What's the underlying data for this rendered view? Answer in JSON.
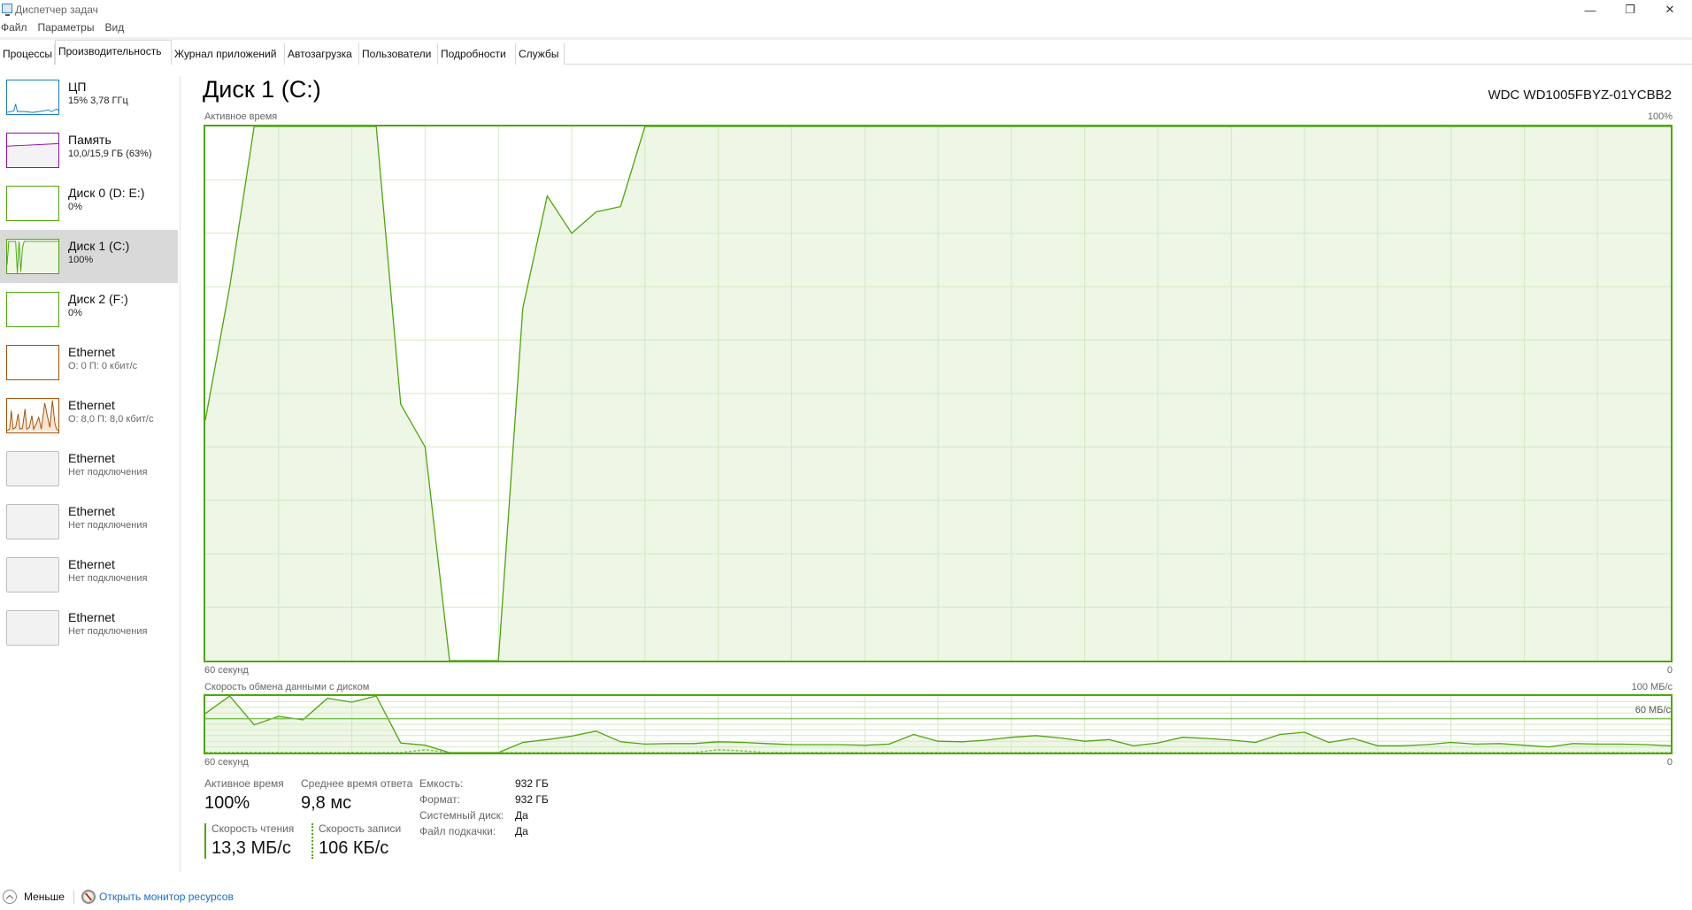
{
  "window": {
    "title": "Диспетчер задач",
    "controls": {
      "minimize": "—",
      "maximize": "❐",
      "close": "✕"
    }
  },
  "menu": [
    "Файл",
    "Параметры",
    "Вид"
  ],
  "tabs": [
    {
      "label": "Процессы",
      "active": false
    },
    {
      "label": "Производительность",
      "active": true
    },
    {
      "label": "Журнал приложений",
      "active": false
    },
    {
      "label": "Автозагрузка",
      "active": false
    },
    {
      "label": "Пользователи",
      "active": false
    },
    {
      "label": "Подробности",
      "active": false
    },
    {
      "label": "Службы",
      "active": false
    }
  ],
  "sidebar": {
    "items": [
      {
        "title": "ЦП",
        "subtitle": "15% 3,78 ГГц",
        "kind": "cpu",
        "color": "#1a7bbf",
        "selected": false
      },
      {
        "title": "Память",
        "subtitle": "10,0/15,9 ГБ (63%)",
        "kind": "memory",
        "color": "#8b12ae",
        "selected": false
      },
      {
        "title": "Диск 0 (D: E:)",
        "subtitle": "0%",
        "kind": "disk-idle",
        "color": "#4da60c",
        "selected": false
      },
      {
        "title": "Диск 1 (C:)",
        "subtitle": "100%",
        "kind": "disk-active",
        "color": "#4da60c",
        "selected": true
      },
      {
        "title": "Диск 2 (F:)",
        "subtitle": "0%",
        "kind": "disk-idle",
        "color": "#4da60c",
        "selected": false
      },
      {
        "title": "Ethernet",
        "subtitle": "О: 0 П: 0 кбит/с",
        "kind": "eth-idle",
        "color": "#a74f01",
        "selected": false
      },
      {
        "title": "Ethernet",
        "subtitle": "О: 8,0 П: 8,0 кбит/с",
        "kind": "eth-active",
        "color": "#a74f01",
        "selected": false
      },
      {
        "title": "Ethernet",
        "subtitle": "Нет подключения",
        "kind": "eth-off",
        "color": "#bdbdbd",
        "selected": false
      },
      {
        "title": "Ethernet",
        "subtitle": "Нет подключения",
        "kind": "eth-off",
        "color": "#bdbdbd",
        "selected": false
      },
      {
        "title": "Ethernet",
        "subtitle": "Нет подключения",
        "kind": "eth-off",
        "color": "#bdbdbd",
        "selected": false
      },
      {
        "title": "Ethernet",
        "subtitle": "Нет подключения",
        "kind": "eth-off",
        "color": "#bdbdbd",
        "selected": false
      }
    ]
  },
  "main": {
    "title": "Диск 1 (C:)",
    "model": "WDC WD1005FBYZ-01YCBB2"
  },
  "chart_data": [
    {
      "type": "area",
      "title": "Активное время",
      "ylabel_max": "100%",
      "xlabel_left": "60 секунд",
      "xlabel_right": "0",
      "ylim": [
        0,
        100
      ],
      "x_range_seconds": [
        60,
        0
      ],
      "grid": {
        "columns": 20,
        "rows": 10
      },
      "color": "#4da60c",
      "fill": "#eef6e6",
      "series": [
        {
          "name": "Активное время",
          "values": [
            45,
            70,
            100,
            100,
            100,
            100,
            100,
            100,
            48,
            40,
            0,
            0,
            0,
            66,
            87,
            80,
            84,
            85,
            100,
            100,
            100,
            100,
            100,
            100,
            100,
            100,
            100,
            100,
            100,
            100,
            100,
            100,
            100,
            100,
            100,
            100,
            100,
            100,
            100,
            100,
            100,
            100,
            100,
            100,
            100,
            100,
            100,
            100,
            100,
            100,
            100,
            100,
            100,
            100,
            100,
            100,
            100,
            100,
            100,
            100,
            100
          ]
        }
      ]
    },
    {
      "type": "area",
      "title": "Скорость обмена данными с диском",
      "ylabel_max": "100 МБ/с",
      "reference_line_label": "60 МБ/с",
      "reference_line_value": 60,
      "xlabel_left": "60 секунд",
      "xlabel_right": "0",
      "ylim": [
        0,
        100
      ],
      "x_range_seconds": [
        60,
        0
      ],
      "grid": {
        "columns": 20,
        "rows": 10
      },
      "color": "#4da60c",
      "fill": "#eef6e6",
      "series": [
        {
          "name": "Скорость чтения",
          "style": "solid",
          "values": [
            69,
            100,
            49,
            64,
            58,
            96,
            89,
            100,
            17,
            13,
            0,
            0,
            0,
            18,
            23,
            29,
            38,
            19,
            15,
            16,
            16,
            19,
            18,
            16,
            14,
            14,
            14,
            13,
            15,
            32,
            20,
            19,
            22,
            27,
            30,
            26,
            20,
            23,
            12,
            17,
            27,
            25,
            22,
            18,
            32,
            36,
            18,
            25,
            12,
            12,
            14,
            18,
            15,
            16,
            13,
            10,
            16,
            15,
            15,
            14,
            12
          ]
        },
        {
          "name": "Скорость записи",
          "style": "dashed",
          "values": [
            0,
            0,
            0,
            0,
            0,
            0,
            0,
            0,
            0,
            5,
            0,
            0,
            0,
            0,
            0,
            0,
            0,
            0,
            0,
            0,
            0,
            5,
            3,
            0,
            0,
            0,
            0,
            0,
            0,
            0,
            0,
            0,
            0,
            0,
            0,
            0,
            0,
            0,
            0,
            0,
            0,
            0,
            0,
            0,
            0,
            0,
            0,
            0,
            0,
            0,
            0,
            0,
            0,
            0,
            0,
            0,
            0,
            0,
            0,
            0,
            0
          ]
        }
      ]
    }
  ],
  "stats": {
    "active_time": {
      "label": "Активное время",
      "value": "100%"
    },
    "avg_response": {
      "label": "Среднее время ответа",
      "value": "9,8 мс"
    },
    "read_speed": {
      "label": "Скорость чтения",
      "value": "13,3 МБ/с"
    },
    "write_speed": {
      "label": "Скорость записи",
      "value": "106 КБ/с"
    }
  },
  "properties": [
    {
      "label": "Емкость:",
      "value": "932 ГБ"
    },
    {
      "label": "Формат:",
      "value": "932 ГБ"
    },
    {
      "label": "Системный диск:",
      "value": "Да"
    },
    {
      "label": "Файл подкачки:",
      "value": "Да"
    }
  ],
  "footer": {
    "less_label": "Меньше",
    "resource_monitor_label": "Открыть монитор ресурсов"
  }
}
